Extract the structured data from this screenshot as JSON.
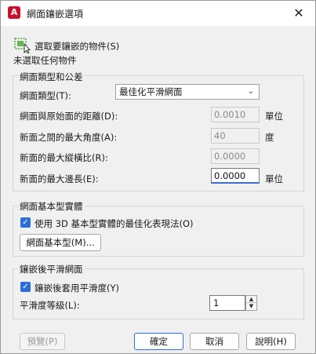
{
  "window": {
    "title": "網面鑲嵌選項",
    "app_icon_letter": "A",
    "close_glyph": "✕"
  },
  "select": {
    "button_label": "選取要鑲嵌的物件(S)",
    "status": "未選取任何物件"
  },
  "mesh_type_group": {
    "legend": "網面類型和公差",
    "type_label": "網面類型(T):",
    "type_value": "最佳化平滑網面",
    "distance_label": "網面與原始面的距離(D):",
    "distance_value": "0.0010",
    "distance_unit": "單位",
    "angle_label": "新面之間的最大角度(A):",
    "angle_value": "40",
    "angle_unit": "度",
    "aspect_label": "新面的最大縱橫比(R):",
    "aspect_value": "0.0000",
    "edge_label": "新面的最大邊長(E):",
    "edge_value": "0.0000",
    "edge_unit": "單位"
  },
  "primitive_group": {
    "legend": "網面基本型實體",
    "checkbox_label": "使用 3D 基本型實體的最佳化表現法(O)",
    "checked": true,
    "button_label": "網面基本型(M)..."
  },
  "smooth_group": {
    "legend": "鑲嵌後平滑網面",
    "checkbox_label": "鑲嵌後套用平滑度(Y)",
    "checked": true,
    "level_label": "平滑度等級(L):",
    "level_value": "1"
  },
  "footer": {
    "preview": "預覽(P)",
    "ok": "確定",
    "cancel": "取消",
    "help": "說明(H)"
  },
  "colors": {
    "accent": "#2b6fd6",
    "app_icon": "#c8102e"
  }
}
